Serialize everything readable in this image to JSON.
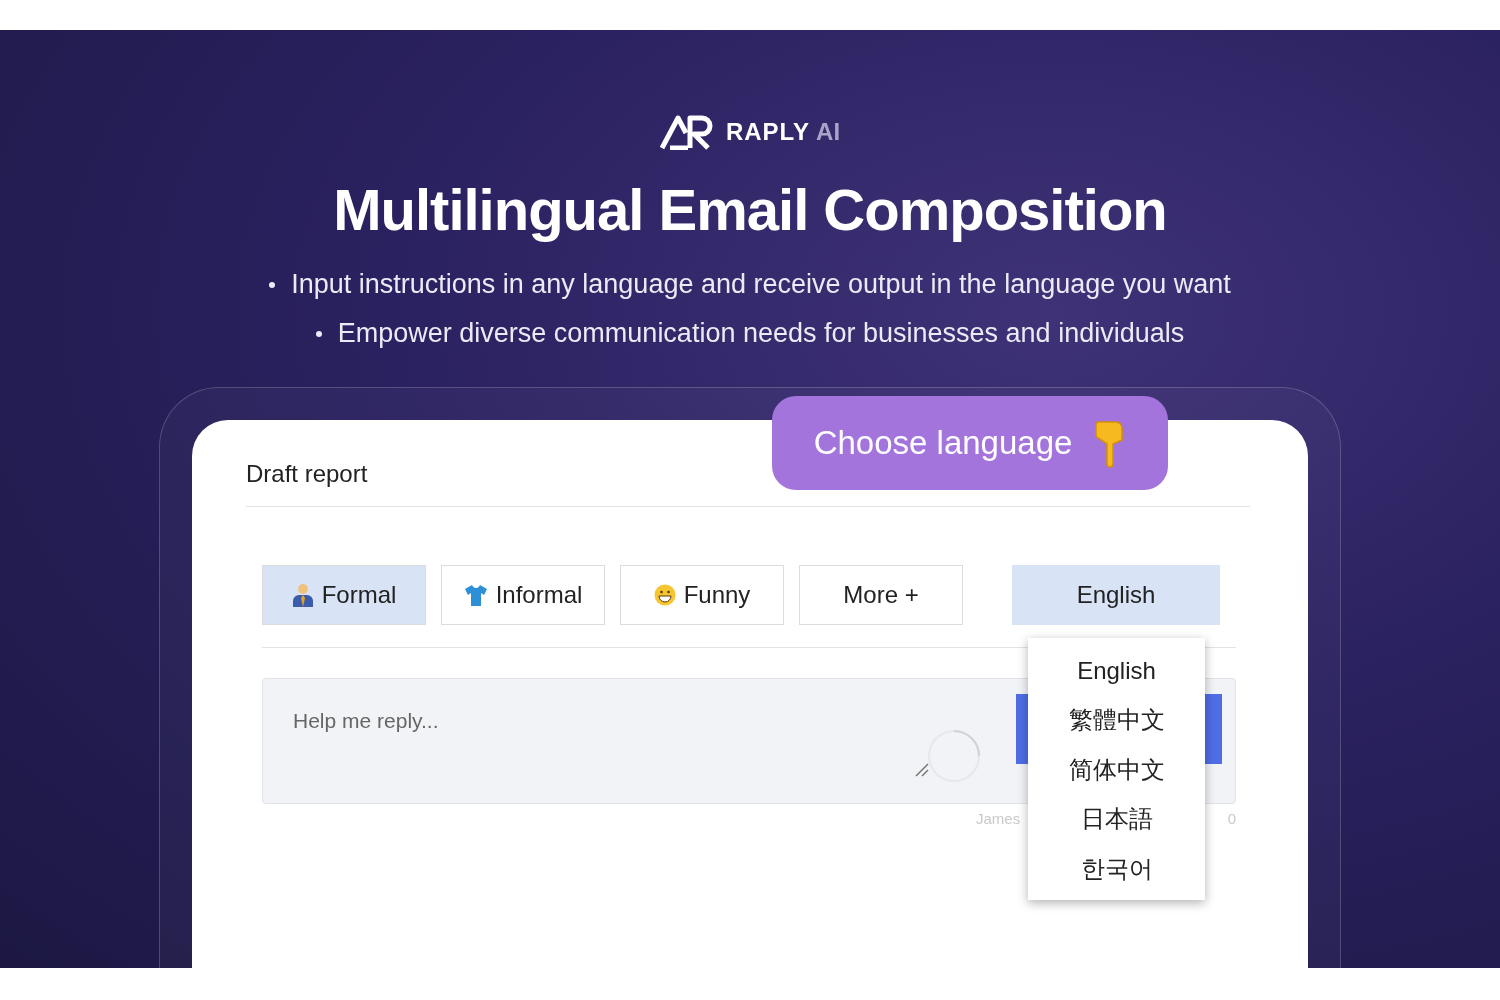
{
  "brand": {
    "name": "RAPLY",
    "suffix": "AI"
  },
  "headline": "Multilingual Email Composition",
  "bullets": [
    "Input instructions in any language and receive output in the language you want",
    "Empower diverse communication needs for businesses and individuals"
  ],
  "callout": {
    "label": "Choose language"
  },
  "card": {
    "title": "Draft report",
    "tones": [
      {
        "label": "Formal",
        "kind": "tie",
        "selected": true
      },
      {
        "label": "Informal",
        "kind": "shirt",
        "selected": false
      },
      {
        "label": "Funny",
        "kind": "smile",
        "selected": false
      },
      {
        "label": "More +",
        "kind": "more",
        "selected": false
      }
    ],
    "language_select": {
      "value": "English",
      "expanded": true,
      "options": [
        "English",
        "繁體中文",
        "简体中文",
        "日本語",
        "한국어"
      ]
    },
    "reply_field": {
      "placeholder": "Help me reply..."
    },
    "footer": {
      "signature": "James",
      "count": "0"
    }
  }
}
